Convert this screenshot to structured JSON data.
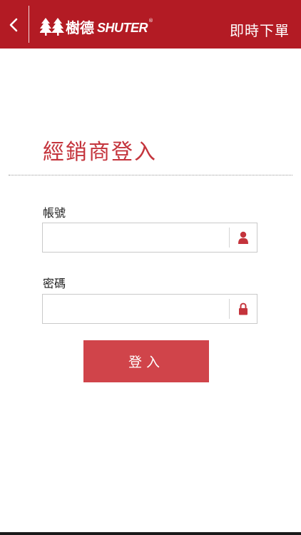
{
  "header": {
    "brand_cjk": "樹德",
    "brand_en": "SHUTER",
    "brand_reg": "®",
    "action_label": "即時下單"
  },
  "login": {
    "title": "經銷商登入",
    "account_label": "帳號",
    "account_value": "",
    "password_label": "密碼",
    "password_value": "",
    "submit_label": "登入"
  },
  "icons": {
    "back": "chevron-left-icon",
    "account": "user-icon",
    "password": "lock-icon"
  },
  "colors": {
    "brand_red": "#b31b24",
    "title_red": "#c4343c",
    "button_red": "#d0444a"
  }
}
